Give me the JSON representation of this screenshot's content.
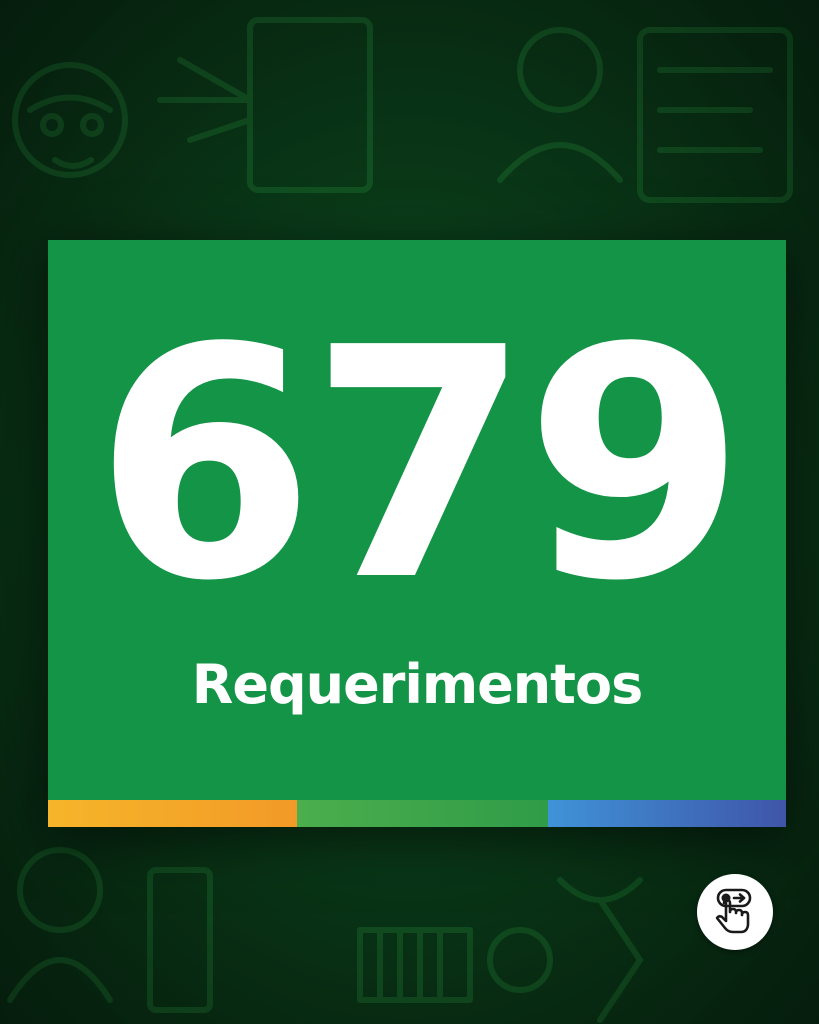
{
  "stat": {
    "number": "679",
    "label": "Requerimentos"
  },
  "colors": {
    "card": "#139447",
    "background": "#0a3a18",
    "bar_yellow": "#f6b52a",
    "bar_green": "#3fa64a",
    "bar_blue": "#3f75c0"
  },
  "icons": {
    "swipe": "swipe-hand-icon"
  }
}
